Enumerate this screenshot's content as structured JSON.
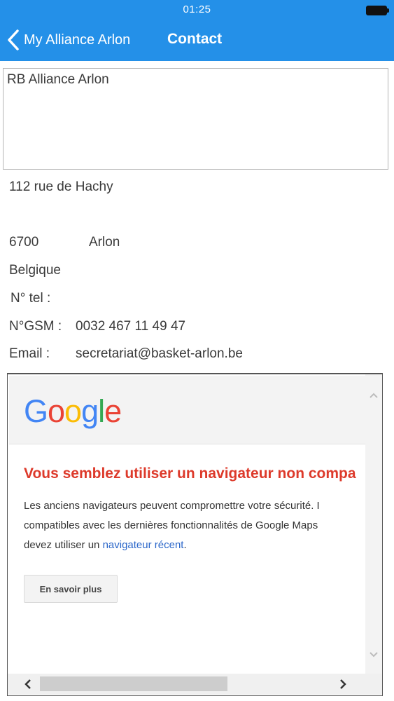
{
  "status_bar": {
    "time": "01:25"
  },
  "nav": {
    "back_label": "My Alliance Arlon",
    "title": "Contact"
  },
  "contact": {
    "name": "RB Alliance Arlon",
    "street": "112 rue de Hachy",
    "postal_code": "6700",
    "city": "Arlon",
    "country": "Belgique",
    "tel_label": "N° tel  :",
    "tel_value": "",
    "gsm_label": "N°GSM :",
    "gsm_value": "0032 467 11 49 47",
    "email_label": "Email :",
    "email_value": "secretariat@basket-arlon.be"
  },
  "map": {
    "logo_letters": [
      "G",
      "o",
      "o",
      "g",
      "l",
      "e"
    ],
    "warning_title": "Vous semblez utiliser un navigateur non compa",
    "warning_line1": "Les anciens navigateurs peuvent compromettre votre sécurité. I",
    "warning_line2": "compatibles avec les dernières fonctionnalités de Google Maps",
    "warning_line3_prefix": "devez utiliser un ",
    "warning_link": "navigateur récent",
    "warning_line3_suffix": ".",
    "learn_more_button": "En savoir plus",
    "horizontal_scroll_position": 0.0
  },
  "colors": {
    "nav_bar": "#2490e8",
    "warning_red": "#dd3a2b",
    "link_blue": "#2a66c9",
    "google_blue": "#4285f4",
    "google_red": "#ea4335",
    "google_yellow": "#fbbc05",
    "google_green": "#34a853"
  }
}
